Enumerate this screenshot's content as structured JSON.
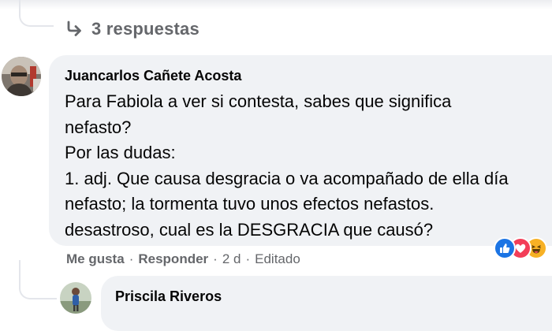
{
  "thread": {
    "replies_label": "3 respuestas"
  },
  "comment": {
    "author": "Juancarlos Cañete Acosta",
    "text": "Para Fabiola a ver si contesta, sabes que significa\nnefasto?\nPor las dudas:\n1. adj. Que causa desgracia o va acompañado de ella día\nnefasto; la tormenta tuvo unos efectos nefastos.\ndesastroso, cual es la DESGRACIA que causó?",
    "reactions": [
      "like-icon",
      "love-icon",
      "haha-icon"
    ],
    "actions": {
      "like_label": "Me gusta",
      "reply_label": "Responder",
      "time": "2 d",
      "edited_label": "Editado",
      "separator": "·"
    }
  },
  "reply": {
    "author": "Priscila Riveros"
  },
  "colors": {
    "bubble": "#f0f2f5",
    "secondary_text": "#65676b",
    "like": "#1b74e4",
    "love": "#f33e58",
    "haha": "#f7b125"
  }
}
